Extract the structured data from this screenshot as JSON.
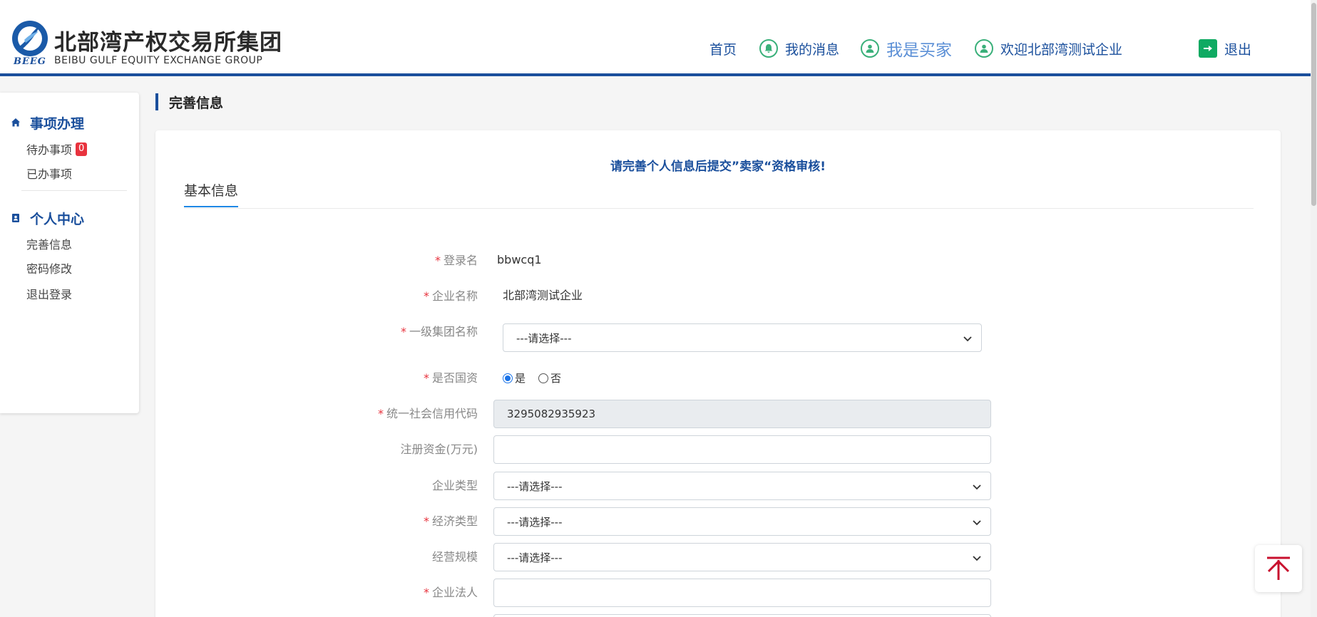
{
  "brand": {
    "cn_name": "北部湾产权交易所集团",
    "en_name": "BEIBU GULF EQUITY EXCHANGE GROUP",
    "abbr": "BEEG",
    "primary_color": "#1a4f9c",
    "accent_green": "#3ab07a"
  },
  "nav": {
    "home": "首页",
    "messages": "我的消息",
    "role": "我是买家",
    "welcome": "欢迎北部湾测试企业",
    "logout": "退出"
  },
  "sidebar": {
    "groups": [
      {
        "title": "事项办理",
        "icon": "home-icon",
        "items": [
          {
            "label": "待办事项",
            "badge": "0"
          },
          {
            "label": "已办事项"
          }
        ]
      },
      {
        "title": "个人中心",
        "icon": "contact-book-icon",
        "items": [
          {
            "label": "完善信息"
          },
          {
            "label": "密码修改"
          },
          {
            "label": "退出登录"
          }
        ]
      }
    ]
  },
  "page": {
    "title": "完善信息",
    "notice": "请完善个人信息后提交”卖家“资格审核!",
    "tab": "基本信息"
  },
  "form": {
    "login_name": {
      "label": "登录名",
      "required": true,
      "value": "bbwcq1"
    },
    "company_name": {
      "label": "企业名称",
      "required": true,
      "value": "北部湾测试企业"
    },
    "group_name": {
      "label": "一级集团名称",
      "required": true,
      "value": "---请选择---"
    },
    "state_owned": {
      "label": "是否国资",
      "required": true,
      "options": [
        "是",
        "否"
      ],
      "selected": "是"
    },
    "credit_code": {
      "label": "统一社会信用代码",
      "required": true,
      "value": "3295082935923"
    },
    "reg_capital": {
      "label": "注册资金(万元)",
      "required": false,
      "value": ""
    },
    "company_type": {
      "label": "企业类型",
      "required": false,
      "value": "---请选择---"
    },
    "economic_type": {
      "label": "经济类型",
      "required": true,
      "value": "---请选择---"
    },
    "business_scale": {
      "label": "经营规模",
      "required": false,
      "value": "---请选择---"
    },
    "legal_person": {
      "label": "企业法人",
      "required": true,
      "value": ""
    }
  }
}
